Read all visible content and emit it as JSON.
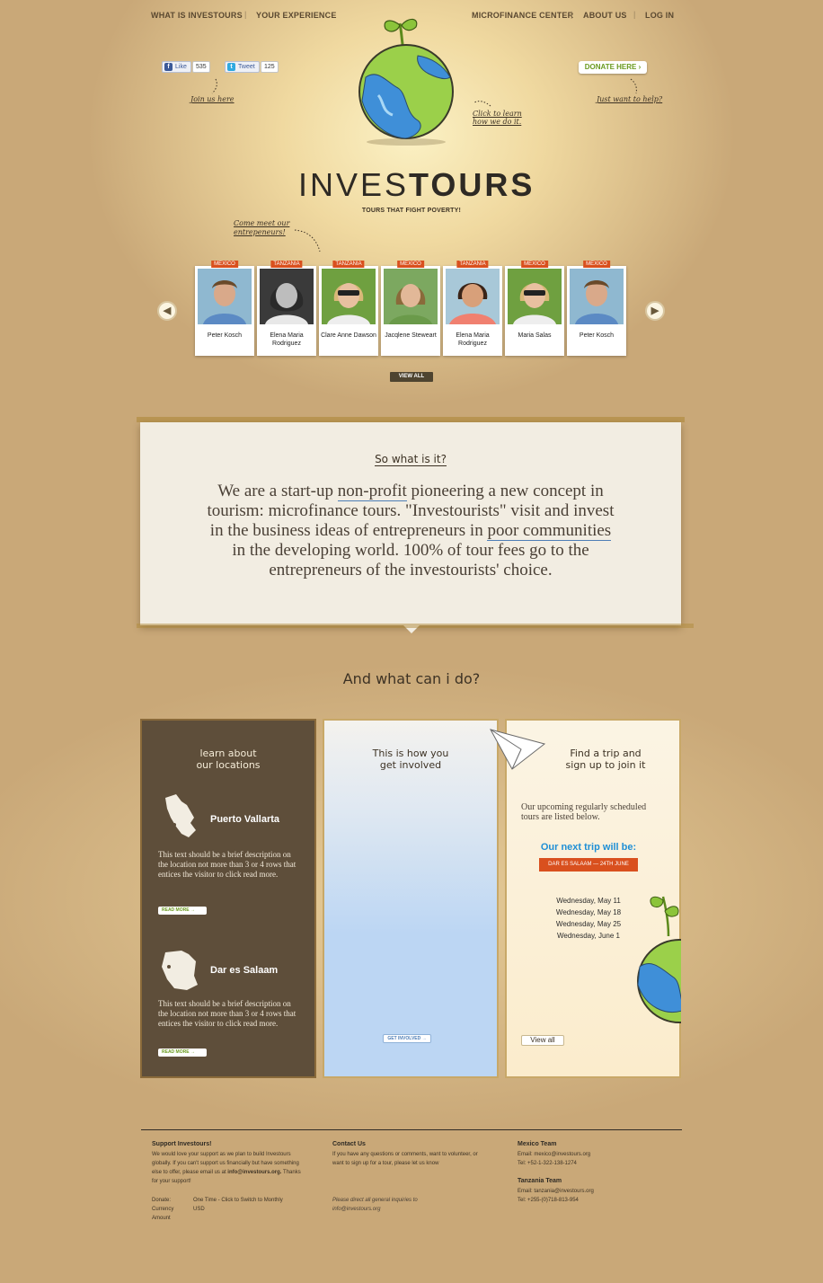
{
  "nav": {
    "left": [
      "WHAT IS INVESTOURS",
      "YOUR EXPERIENCE"
    ],
    "right": [
      "MICROFINANCE CENTER",
      "ABOUT US",
      "LOG IN"
    ]
  },
  "social": {
    "like_label": "Like",
    "like_count": "535",
    "tweet_label": "Tweet",
    "tweet_count": "125",
    "join_note": "Join us here"
  },
  "donate": {
    "label": "DONATE HERE",
    "note": "Just want to help?"
  },
  "globe_note": "Click to learn how we do it.",
  "brand": {
    "name_thin": "INVES",
    "name_bold": "TOURS",
    "tagline": "TOURS THAT FIGHT POVERTY!"
  },
  "entrepreneurs": {
    "note": "Come meet our entrepeneurs!",
    "view_all": "VIEW ALL",
    "items": [
      {
        "name": "Peter Kosch",
        "country": "MEXICO"
      },
      {
        "name": "Elena Maria Rodriguez",
        "country": "TANZANIA"
      },
      {
        "name": "Clare Anne Dawson",
        "country": "TANZANIA"
      },
      {
        "name": "Jacqlene Steweart",
        "country": "MEXICO"
      },
      {
        "name": "Elena Maria Rodriguez",
        "country": "TANZANIA"
      },
      {
        "name": "Maria Salas",
        "country": "MEXICO"
      },
      {
        "name": "Peter Kosch",
        "country": "MEXICO"
      }
    ]
  },
  "about": {
    "title": "So what is it?",
    "text_1": "We are a start-up ",
    "link_1": "non-profit",
    "text_2": " pioneering a new concept in tourism: microfinance tours. \"Investourists\" visit and invest in the business ideas of entrepreneurs in ",
    "link_2": "poor communities",
    "text_3": " in the developing world. 100% of tour fees go to the entrepreneurs of the investourists' choice."
  },
  "what_can_i_do": "And what can i do?",
  "locations": {
    "title_1": "learn about",
    "title_2": "our locations",
    "items": [
      {
        "name": "Puerto Vallarta",
        "text": "This text should be a brief description on the location not more than 3 or 4 rows that entices the visitor to click read more.",
        "button": "READ MORE"
      },
      {
        "name": "Dar es Salaam",
        "text": "This text should be a brief description on the location not more than 3 or 4 rows that entices the visitor to click read more.",
        "button": "READ MORE"
      }
    ]
  },
  "involved": {
    "title_1": "This is how you",
    "title_2": "get involved",
    "button": "GET INVOLVED"
  },
  "trip": {
    "title_1": "Find a trip and",
    "title_2": "sign up to join it",
    "intro": "Our upcoming regularly scheduled tours are listed below.",
    "next_label": "Our next trip will be:",
    "badge": "DAR ES SALAAM — 24TH JUNE",
    "dates": [
      "Wednesday, May 11",
      "Wednesday, May 18",
      "Wednesday, May 25",
      "Wednesday, June 1"
    ],
    "view_all": "View all"
  },
  "footer": {
    "support_title": "Support Investours!",
    "support_text": "We would love your support as we plan to build Investours globally. If you can't support us financially but have something else to offer, please email us at",
    "support_email": "info@investours.org.",
    "support_thanks": "Thanks for your support!",
    "donate_label": "Donate:",
    "donate_value": "One Time - Click to Switch to Monthly",
    "currency_label": "Currency",
    "currency_value": "USD",
    "amount_label": "Amount",
    "contact_title": "Contact Us",
    "contact_text": "If you have any questions or comments, want to volunteer, or want to sign up for a tour, please let us know",
    "contact_note": "Please direct all general inquiries to info@investours.org",
    "mexico_title": "Mexico Team",
    "mexico_email": "Email: mexico@investours.org",
    "mexico_tel": "Tel: +52-1-322-138-1274",
    "tanzania_title": "Tanzania Team",
    "tanzania_email": "Email: tanzania@investours.org",
    "tanzania_tel": "Tel: +255-(0)718-813-954"
  }
}
